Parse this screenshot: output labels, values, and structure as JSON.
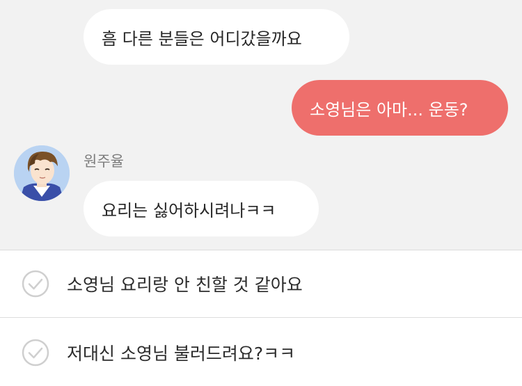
{
  "messages": [
    {
      "direction": "incoming",
      "text": "흠 다른 분들은 어디갔을까요"
    },
    {
      "direction": "outgoing",
      "text": "소영님은  아마... 운동?"
    },
    {
      "direction": "incoming",
      "sender": "원주율",
      "text": "요리는 싫어하시려나ㅋㅋ"
    }
  ],
  "choices": [
    {
      "label": "소영님 요리랑 안 친할 것 같아요",
      "icon": "check-circle-icon"
    },
    {
      "label": "저대신 소영님 불러드려요?ㅋㅋ",
      "icon": "check-circle-icon"
    }
  ],
  "colors": {
    "chat_background": "#f2f2f2",
    "incoming_bubble": "#ffffff",
    "outgoing_bubble": "#ee6f6c",
    "divider": "#dcdcdc"
  }
}
